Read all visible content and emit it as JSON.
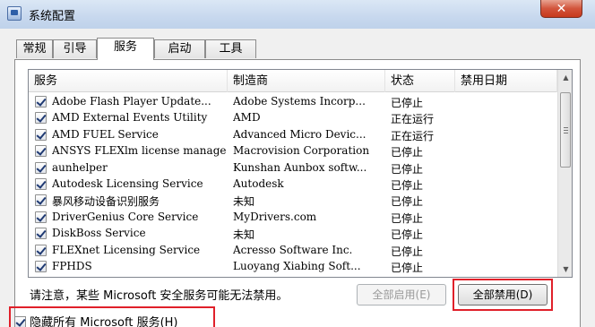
{
  "window": {
    "title": "系统配置",
    "close_glyph": "✕"
  },
  "tabs": [
    {
      "label": "常规",
      "active": false
    },
    {
      "label": "引导",
      "active": false
    },
    {
      "label": "服务",
      "active": true
    },
    {
      "label": "启动",
      "active": false
    },
    {
      "label": "工具",
      "active": false
    }
  ],
  "services": {
    "columns": [
      "服务",
      "制造商",
      "状态",
      "禁用日期"
    ],
    "rows": [
      {
        "checked": true,
        "name": "Adobe Flash Player Update...",
        "maker": "Adobe Systems Incorp...",
        "status": "已停止"
      },
      {
        "checked": true,
        "name": "AMD External Events Utility",
        "maker": "AMD",
        "status": "正在运行"
      },
      {
        "checked": true,
        "name": "AMD FUEL Service",
        "maker": "Advanced Micro Devic...",
        "status": "正在运行"
      },
      {
        "checked": true,
        "name": "ANSYS FLEXlm license manager",
        "maker": "Macrovision Corporation",
        "status": "已停止"
      },
      {
        "checked": true,
        "name": "aunhelper",
        "maker": "Kunshan Aunbox softw...",
        "status": "已停止"
      },
      {
        "checked": true,
        "name": "Autodesk Licensing Service",
        "maker": "Autodesk",
        "status": "已停止"
      },
      {
        "checked": true,
        "name": "暴风移动设备识别服务",
        "maker": "未知",
        "status": "已停止"
      },
      {
        "checked": true,
        "name": "DriverGenius Core Service",
        "maker": "MyDrivers.com",
        "status": "已停止"
      },
      {
        "checked": true,
        "name": "DiskBoss Service",
        "maker": "未知",
        "status": "已停止"
      },
      {
        "checked": true,
        "name": "FLEXnet Licensing Service",
        "maker": "Acresso Software Inc.",
        "status": "已停止"
      },
      {
        "checked": true,
        "name": "FPHDS",
        "maker": "Luoyang Xiabing Soft...",
        "status": "已停止"
      }
    ]
  },
  "footer": {
    "notice": "请注意，某些 Microsoft 安全服务可能无法禁用。",
    "enable_all_label": "全部启用(E)",
    "disable_all_label": "全部禁用(D)",
    "hide_ms_label": "隐藏所有 Microsoft 服务(H)",
    "hide_ms_checked": true
  },
  "colors": {
    "highlight": "#e0202a"
  }
}
